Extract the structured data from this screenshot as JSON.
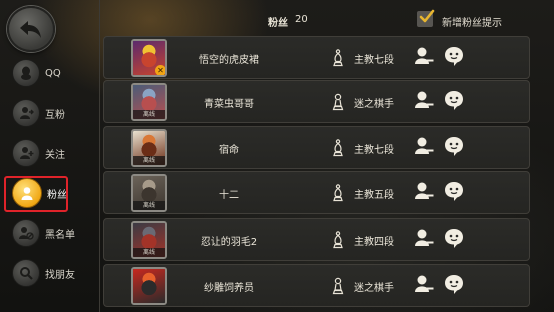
{
  "sidebar": {
    "items": [
      {
        "label": "QQ",
        "icon": "qq-icon"
      },
      {
        "label": "互粉",
        "icon": "mutual-fans-icon"
      },
      {
        "label": "关注",
        "icon": "follow-icon"
      },
      {
        "label": "粉丝",
        "icon": "fans-icon",
        "active": true
      },
      {
        "label": "黑名单",
        "icon": "blacklist-icon"
      },
      {
        "label": "找朋友",
        "icon": "find-friends-icon"
      }
    ]
  },
  "header": {
    "title": "粉丝",
    "count": "20",
    "notify_checkbox_label": "新增粉丝提示",
    "notify_checked": true
  },
  "fans": [
    {
      "name": "悟空的虎皮裙",
      "rank": "主教七段",
      "rank_icon": "bishop-icon",
      "offline": "",
      "badge": "✕",
      "palette": [
        "#5b2a6d",
        "#c8442e",
        "#f0c233"
      ]
    },
    {
      "name": "青菜虫哥哥",
      "rank": "迷之棋手",
      "rank_icon": "pawn-outline-icon",
      "offline": "离线",
      "palette": [
        "#4b5c78",
        "#b84f4f",
        "#8aa3c4"
      ]
    },
    {
      "name": "宿命",
      "rank": "主教七段",
      "rank_icon": "bishop-icon",
      "offline": "离线",
      "palette": [
        "#e9e1cf",
        "#6b2d16",
        "#d97836"
      ]
    },
    {
      "name": "十二",
      "rank": "主教五段",
      "rank_icon": "bishop-icon",
      "offline": "离线",
      "palette": [
        "#6b6359",
        "#3c352e",
        "#a79b8a"
      ]
    },
    {
      "name": "忍让的羽毛2",
      "rank": "主教四段",
      "rank_icon": "bishop-icon",
      "offline": "离线",
      "palette": [
        "#3b3b44",
        "#a33328",
        "#6a6a74"
      ]
    },
    {
      "name": "纱雕饲养员",
      "rank": "迷之棋手",
      "rank_icon": "pawn-outline-icon",
      "offline": "",
      "palette": [
        "#c7281f",
        "#2b2b2b",
        "#e8612c"
      ]
    }
  ],
  "colors": {
    "accent_gold": "#f0a815",
    "highlight_red": "#e0232a",
    "row_bg": "#2b2b28"
  }
}
